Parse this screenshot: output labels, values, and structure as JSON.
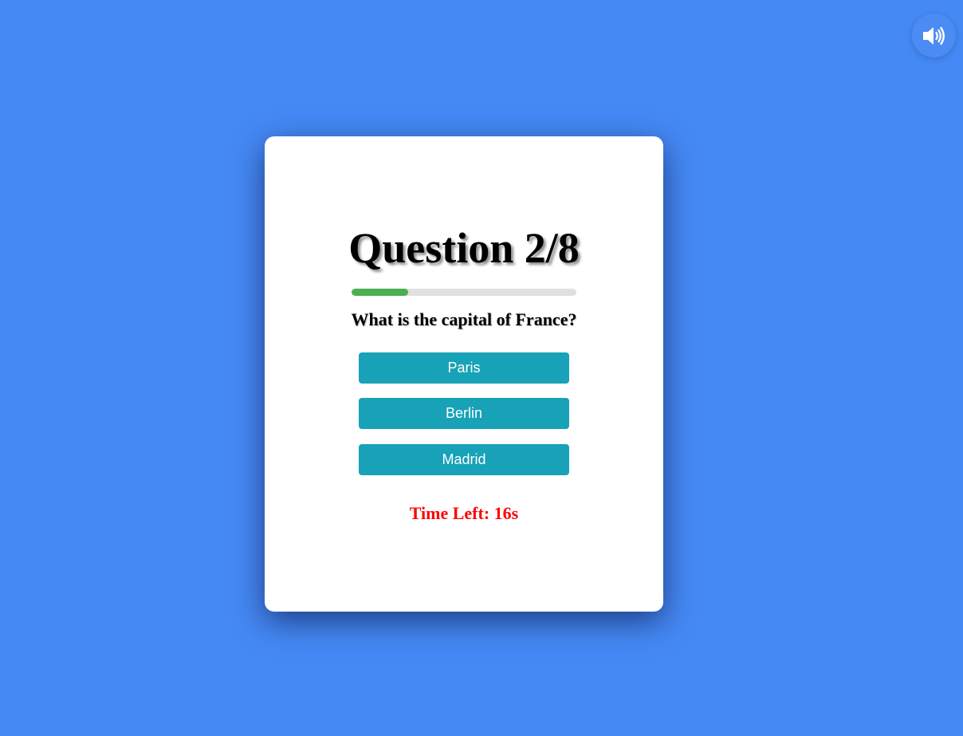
{
  "page": {
    "background_color": "#4589f5"
  },
  "sound_toggle": {
    "icon": "speaker-volume-icon",
    "state": "on"
  },
  "quiz": {
    "title": "Question 2/8",
    "progress": {
      "current": 2,
      "total": 8,
      "fraction": 0.25,
      "fill_color": "#4caf50",
      "track_color": "#e0e0e0"
    },
    "question": "What is the capital of France?",
    "options": [
      {
        "label": "Paris"
      },
      {
        "label": "Berlin"
      },
      {
        "label": "Madrid"
      }
    ],
    "option_color": "#17a2b8",
    "timer_text": "Time Left: 16s",
    "timer_color": "#ff0000"
  }
}
